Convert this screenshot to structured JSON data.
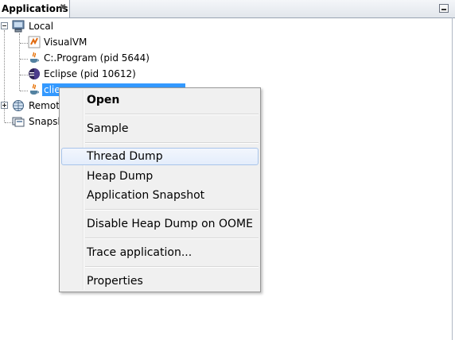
{
  "panel": {
    "tab_title": "Applications",
    "tab_close_icon": "close-icon",
    "minimize_icon": "minimize-icon"
  },
  "tree": {
    "local": {
      "label": "Local",
      "icon": "computer-icon",
      "expanded": true,
      "children": [
        {
          "label": "VisualVM",
          "icon": "visualvm-icon"
        },
        {
          "label": "C:.Program (pid 5644)",
          "icon": "java-icon"
        },
        {
          "label": "Eclipse (pid 10612)",
          "icon": "eclipse-icon"
        },
        {
          "label": "clie",
          "icon": "java-icon",
          "selected": true
        }
      ]
    },
    "remote": {
      "label": "Remot",
      "icon": "remote-hosts-icon",
      "expanded": false
    },
    "snapshots": {
      "label": "Snapsh",
      "icon": "snapshots-icon"
    }
  },
  "context_menu": {
    "items": [
      {
        "label": "Open",
        "bold": true
      },
      {
        "label": "Sample"
      },
      {
        "label": "Thread Dump",
        "highlighted": true
      },
      {
        "label": "Heap Dump"
      },
      {
        "label": "Application Snapshot"
      },
      {
        "label": "Disable Heap Dump on OOME"
      },
      {
        "label": "Trace application..."
      },
      {
        "label": "Properties"
      }
    ]
  },
  "colors": {
    "selection": "#3399ff",
    "menu_background": "#f0f0f0",
    "menu_hover_border": "#a8c4ea"
  }
}
